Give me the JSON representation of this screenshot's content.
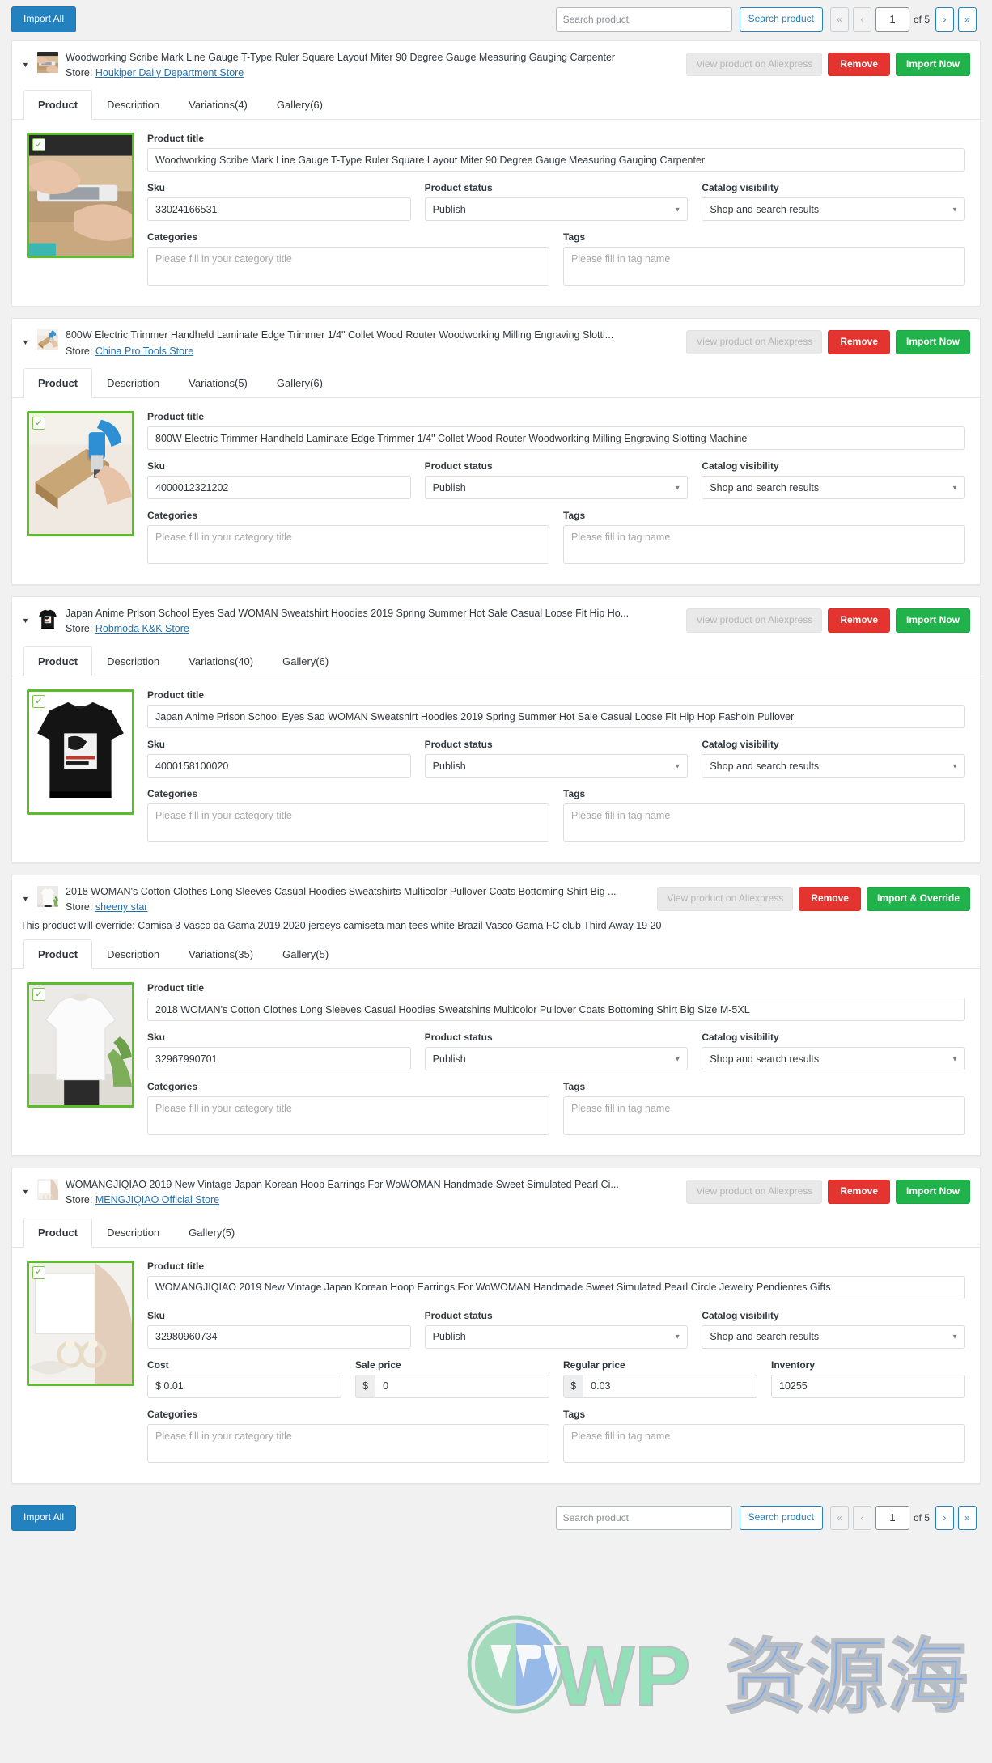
{
  "toolbar": {
    "import_all_label": "Import All",
    "search_placeholder": "Search product",
    "search_value": "",
    "search_button_label": "Search product",
    "pager": {
      "first_label": "«",
      "prev_label": "‹",
      "page_value": "1",
      "of_label": "of 5",
      "next_label": "›",
      "last_label": "»"
    }
  },
  "labels": {
    "store_prefix": "Store:",
    "view_product": "View product on Aliexpress",
    "remove": "Remove",
    "import_now": "Import Now",
    "import_override": "Import & Override",
    "product_title": "Product title",
    "sku": "Sku",
    "product_status": "Product status",
    "catalog_visibility": "Catalog visibility",
    "categories": "Categories",
    "tags": "Tags",
    "cost": "Cost",
    "sale_price": "Sale price",
    "regular_price": "Regular price",
    "inventory": "Inventory",
    "categories_placeholder": "Please fill in your category title",
    "tags_placeholder": "Please fill in tag name",
    "currency_symbol": "$"
  },
  "colors": {
    "accent_blue": "#2481c0",
    "danger_red": "#e3342f",
    "success_green": "#22b24c",
    "image_border_green": "#5bbd2a",
    "link_blue": "#2271b1"
  },
  "products": [
    {
      "title": "Woodworking Scribe Mark Line Gauge T-Type Ruler Square Layout Miter 90 Degree Gauge Measuring Gauging Carpenter",
      "store": "Houkiper Daily Department Store",
      "import_label": "Import Now",
      "override_note": "",
      "tabs": [
        {
          "label": "Product",
          "active": true
        },
        {
          "label": "Description",
          "active": false
        },
        {
          "label": "Variations(4)",
          "active": false
        },
        {
          "label": "Gallery(6)",
          "active": false
        }
      ],
      "product_title_value": "Woodworking Scribe Mark Line Gauge T-Type Ruler Square Layout Miter 90 Degree Gauge Measuring Gauging Carpenter",
      "sku": "33024166531",
      "status": "Publish",
      "visibility": "Shop and search results",
      "categories_value": "",
      "tags_value": "",
      "has_price_row": false,
      "image_theme": "wood-hands"
    },
    {
      "title": "800W Electric Trimmer Handheld Laminate Edge Trimmer 1/4\" Collet Wood Router Woodworking Milling Engraving Slotti...",
      "store": "China Pro Tools Store",
      "import_label": "Import Now",
      "override_note": "",
      "tabs": [
        {
          "label": "Product",
          "active": true
        },
        {
          "label": "Description",
          "active": false
        },
        {
          "label": "Variations(5)",
          "active": false
        },
        {
          "label": "Gallery(6)",
          "active": false
        }
      ],
      "product_title_value": "800W Electric Trimmer Handheld Laminate Edge Trimmer 1/4\" Collet Wood Router Woodworking Milling Engraving Slotting Machine",
      "sku": "4000012321202",
      "status": "Publish",
      "visibility": "Shop and search results",
      "categories_value": "",
      "tags_value": "",
      "has_price_row": false,
      "image_theme": "trimmer"
    },
    {
      "title": "Japan Anime Prison School Eyes Sad WOMAN Sweatshirt Hoodies 2019 Spring Summer Hot Sale Casual Loose Fit Hip Ho...",
      "store": "Robmoda K&K Store",
      "import_label": "Import Now",
      "override_note": "",
      "tabs": [
        {
          "label": "Product",
          "active": true
        },
        {
          "label": "Description",
          "active": false
        },
        {
          "label": "Variations(40)",
          "active": false
        },
        {
          "label": "Gallery(6)",
          "active": false
        }
      ],
      "product_title_value": "Japan Anime Prison School Eyes Sad WOMAN Sweatshirt Hoodies 2019 Spring Summer Hot Sale Casual Loose Fit Hip Hop Fashoin Pullover",
      "sku": "4000158100020",
      "status": "Publish",
      "visibility": "Shop and search results",
      "categories_value": "",
      "tags_value": "",
      "has_price_row": false,
      "image_theme": "black-hoodie"
    },
    {
      "title": "2018 WOMAN's Cotton Clothes Long Sleeves Casual Hoodies Sweatshirts Multicolor Pullover Coats Bottoming Shirt Big ...",
      "store": "sheeny star",
      "import_label": "Import & Override",
      "override_note": "This product will override: Camisa 3 Vasco da Gama 2019 2020 jerseys camiseta man tees white Brazil Vasco Gama FC club Third Away 19 20",
      "tabs": [
        {
          "label": "Product",
          "active": true
        },
        {
          "label": "Description",
          "active": false
        },
        {
          "label": "Variations(35)",
          "active": false
        },
        {
          "label": "Gallery(5)",
          "active": false
        }
      ],
      "product_title_value": "2018 WOMAN's Cotton Clothes Long Sleeves Casual Hoodies Sweatshirts Multicolor Pullover Coats Bottoming Shirt Big Size M-5XL",
      "sku": "32967990701",
      "status": "Publish",
      "visibility": "Shop and search results",
      "categories_value": "",
      "tags_value": "",
      "has_price_row": false,
      "image_theme": "white-sweater"
    },
    {
      "title": "WOMANGJIQIAO 2019 New Vintage Japan Korean Hoop Earrings For WoWOMAN Handmade Sweet Simulated Pearl Ci...",
      "store": "MENGJIQIAO Official Store",
      "import_label": "Import Now",
      "override_note": "",
      "tabs": [
        {
          "label": "Product",
          "active": true
        },
        {
          "label": "Description",
          "active": false
        },
        {
          "label": "Gallery(5)",
          "active": false
        }
      ],
      "product_title_value": "WOMANGJIQIAO 2019 New Vintage Japan Korean Hoop Earrings For WoWOMAN Handmade Sweet Simulated Pearl Circle Jewelry Pendientes Gifts",
      "sku": "32980960734",
      "status": "Publish",
      "visibility": "Shop and search results",
      "categories_value": "",
      "tags_value": "",
      "has_price_row": true,
      "cost": "$ 0.01",
      "sale_price": "0",
      "regular_price": "0.03",
      "inventory": "10255",
      "image_theme": "earrings"
    }
  ],
  "watermark": {
    "text_latin": "WP",
    "text_cjk": "资源海"
  }
}
